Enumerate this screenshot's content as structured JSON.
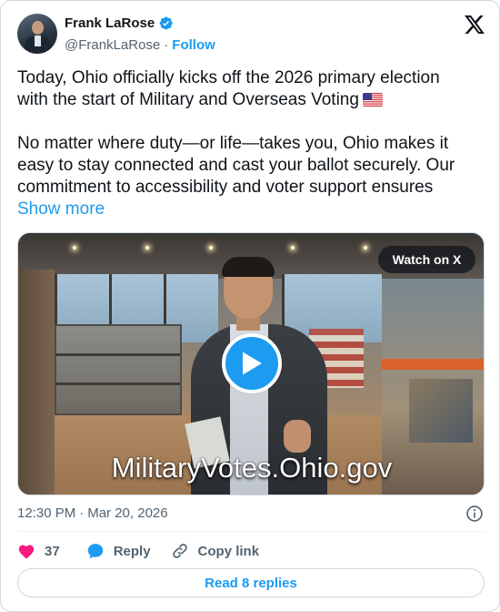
{
  "author": {
    "display_name": "Frank LaRose",
    "handle": "@FrankLaRose",
    "separator": "·",
    "follow_label": "Follow"
  },
  "tweet": {
    "line1": "Today, Ohio officially kicks off the 2026 primary election",
    "line2": "with the start of Military and Overseas Voting",
    "paragraph2": "No matter where duty—or life—takes you, Ohio makes it easy to stay connected and cast your ballot securely. Our commitment to accessibility and voter support ensures",
    "show_more_label": "Show more"
  },
  "media": {
    "watch_label": "Watch on X",
    "caption": "MilitaryVotes.Ohio.gov"
  },
  "meta": {
    "time": "12:30 PM",
    "separator": "·",
    "date": "Mar 20, 2026"
  },
  "actions": {
    "like_count": "37",
    "reply_label": "Reply",
    "copy_label": "Copy link"
  },
  "read_replies_label": "Read 8 replies",
  "icons": {
    "verified": "verified-badge-icon",
    "logo": "x-logo-icon",
    "info": "info-icon",
    "like": "heart-icon",
    "reply": "chat-bubble-icon",
    "copy": "link-icon",
    "play": "play-icon",
    "flag": "us-flag-icon"
  },
  "colors": {
    "accent": "#1d9bf0",
    "like": "#f91880",
    "text": "#0f1419",
    "muted": "#536471",
    "border": "#cfd9de"
  }
}
